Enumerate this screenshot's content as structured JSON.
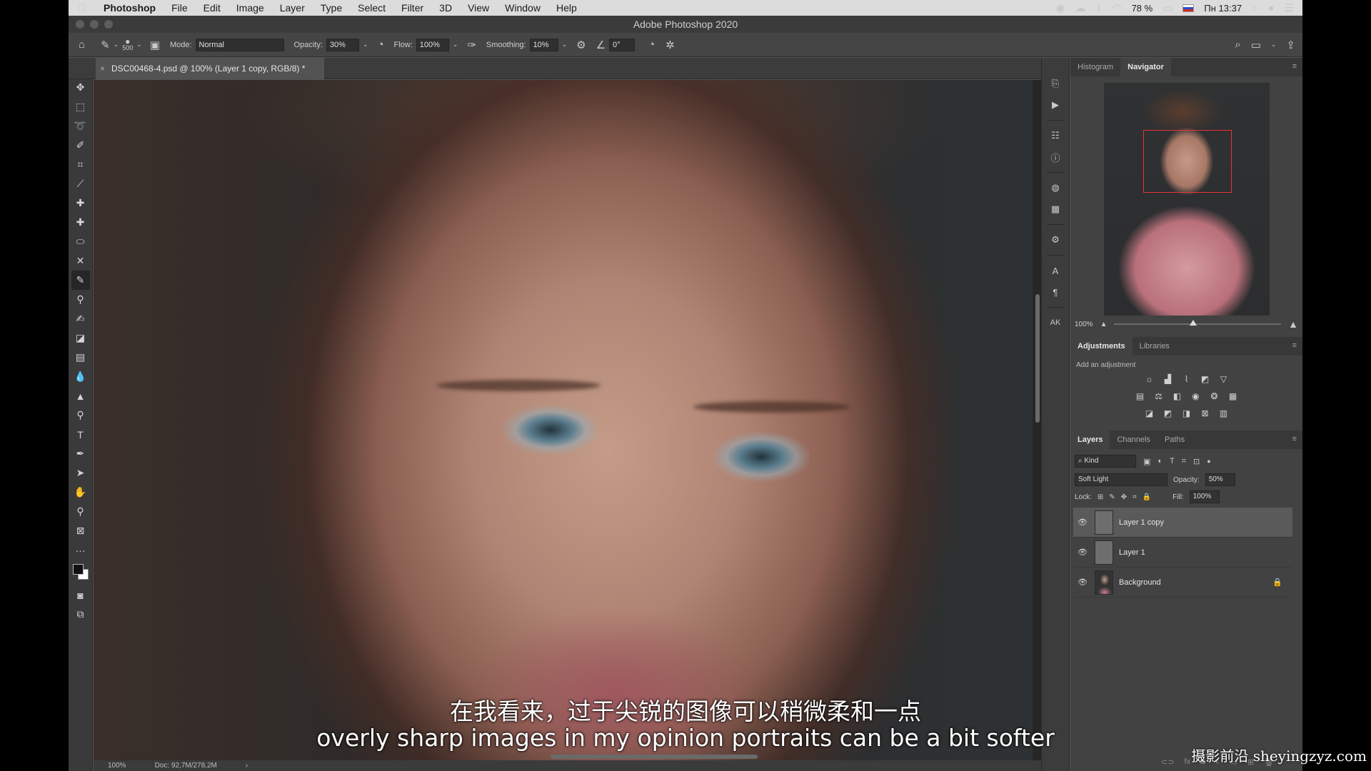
{
  "menubar": {
    "app": "Photoshop",
    "items": [
      "File",
      "Edit",
      "Image",
      "Layer",
      "Type",
      "Select",
      "Filter",
      "3D",
      "View",
      "Window",
      "Help"
    ],
    "battery": "78 %",
    "clock": "Пн 13:37"
  },
  "window": {
    "title": "Adobe Photoshop 2020"
  },
  "options": {
    "brush_size": "500",
    "mode_label": "Mode:",
    "mode_value": "Normal",
    "opacity_label": "Opacity:",
    "opacity_value": "30%",
    "flow_label": "Flow:",
    "flow_value": "100%",
    "smoothing_label": "Smoothing:",
    "smoothing_value": "10%",
    "angle_value": "0°"
  },
  "document": {
    "tab_title": "DSC00468-4.psd @ 100% (Layer 1 copy, RGB/8) *",
    "close": "×"
  },
  "status": {
    "zoom": "100%",
    "doc": "Doc: 92,7M/278,2M",
    "arrow": "›"
  },
  "navigator": {
    "tabs": [
      "Histogram",
      "Navigator"
    ],
    "active_tab": "Navigator",
    "zoom": "100%",
    "zoom_fraction": 0.45
  },
  "adjustments": {
    "tabs": [
      "Adjustments",
      "Libraries"
    ],
    "hint": "Add an adjustment"
  },
  "layers_panel": {
    "tabs": [
      "Layers",
      "Channels",
      "Paths"
    ],
    "filter_label": "Kind",
    "blend_mode": "Soft Light",
    "opacity_label": "Opacity:",
    "opacity_value": "50%",
    "lock_label": "Lock:",
    "fill_label": "Fill:",
    "fill_value": "100%",
    "layers": [
      {
        "name": "Layer 1 copy",
        "selected": true
      },
      {
        "name": "Layer 1",
        "selected": false
      },
      {
        "name": "Background",
        "selected": false,
        "locked": true
      }
    ]
  },
  "subtitles": {
    "chinese": "在我看来，过于尖锐的图像可以稍微柔和一点",
    "english": "overly sharp images in my opinion portraits can be a bit softer"
  },
  "watermark": "摄影前沿 sheyingzyz.com"
}
